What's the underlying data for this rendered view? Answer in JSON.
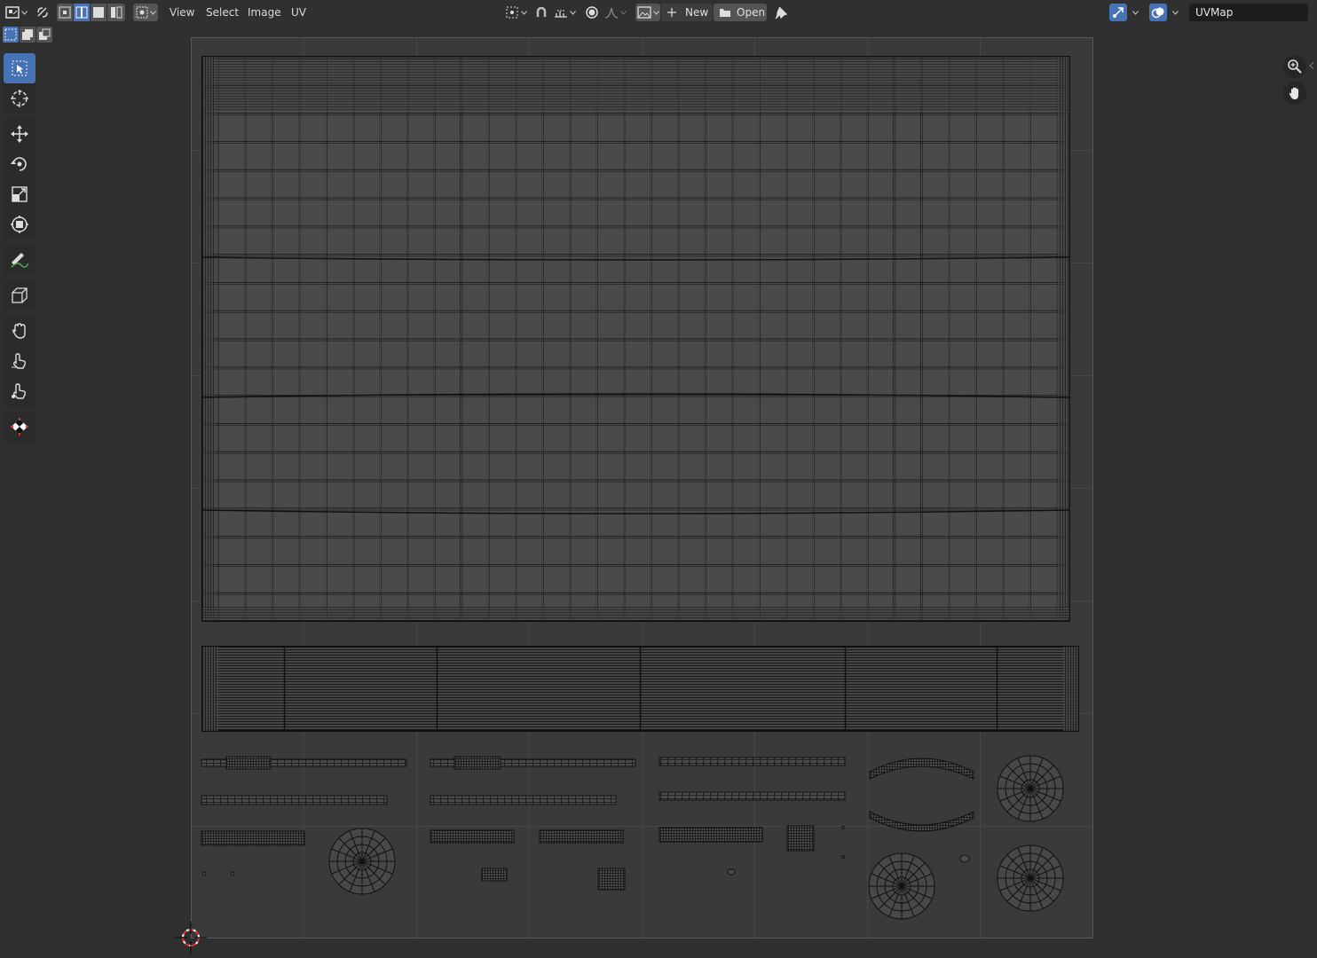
{
  "header": {
    "menus": [
      {
        "label": "View"
      },
      {
        "label": "Select"
      },
      {
        "label": "Image"
      },
      {
        "label": "UV"
      }
    ],
    "new_label": "New",
    "open_label": "Open",
    "uv_map_name": "UVMap"
  },
  "select_modes": [
    "select-vertex-mode",
    "select-edge-mode",
    "select-face-mode"
  ],
  "tools": [
    "select-box-tool",
    "cursor-tool",
    "move-tool",
    "rotate-tool",
    "scale-tool",
    "transform-tool",
    "annotate-tool",
    "rip-region-tool",
    "grab-tool",
    "relax-tool",
    "pinch-tool",
    "sample-tool"
  ],
  "colors": {
    "background": "#2f2f2f",
    "header": "#303030",
    "accent": "#4772b3",
    "uv_space": "#3a3a3a",
    "uv_faces": "#484848",
    "uv_edges": "#0f0f0f",
    "cursor": "#e03030"
  }
}
